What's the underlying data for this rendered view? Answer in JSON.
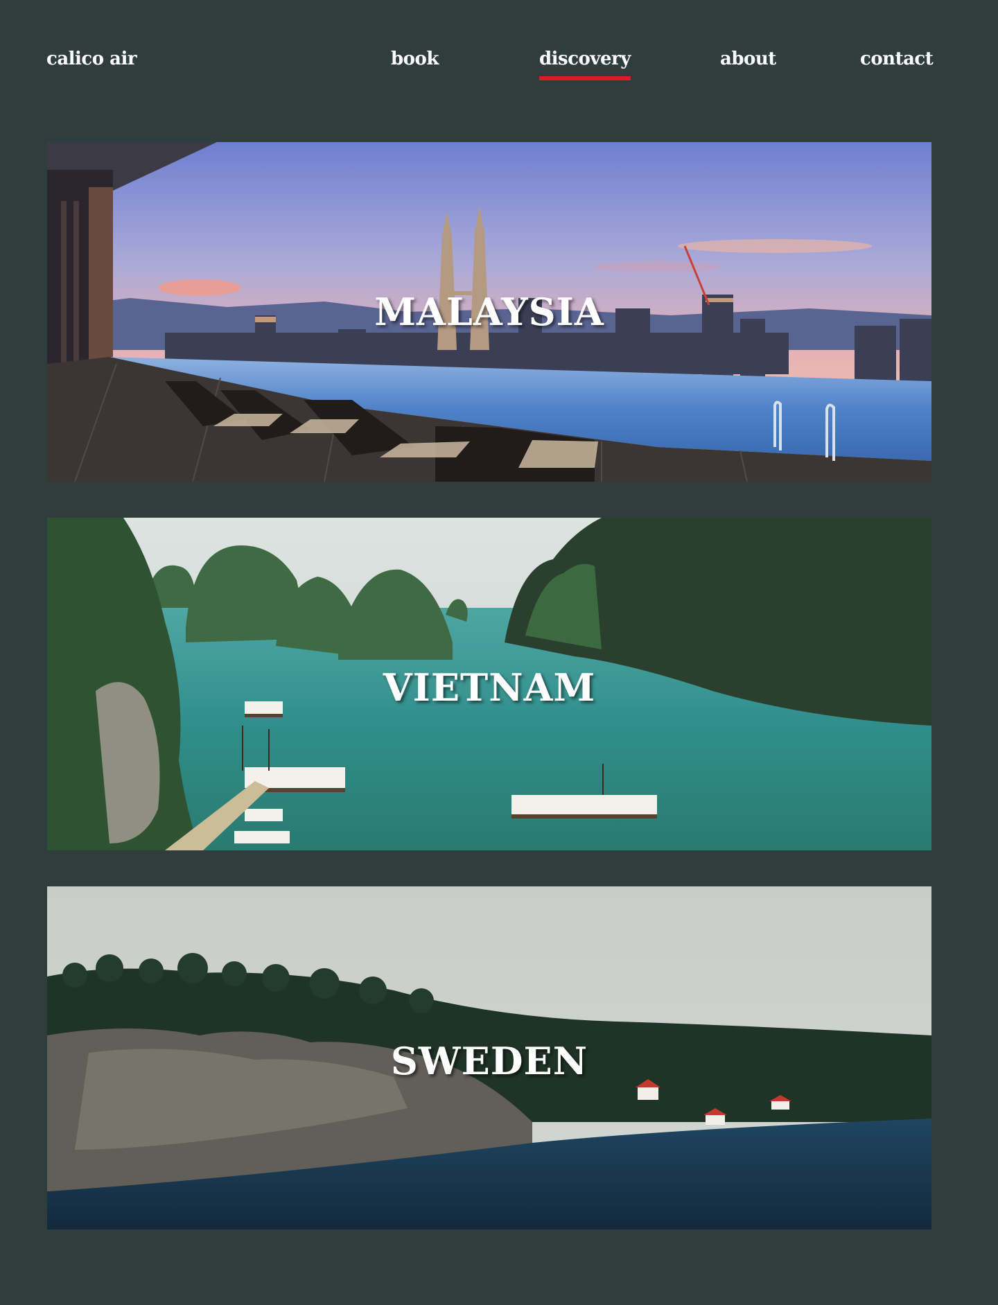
{
  "brand": "calico air",
  "nav": {
    "items": [
      {
        "label": "book",
        "active": false
      },
      {
        "label": "discovery",
        "active": true
      },
      {
        "label": "about",
        "active": false
      },
      {
        "label": "contact",
        "active": false
      }
    ]
  },
  "destinations": [
    {
      "name": "MALAYSIA"
    },
    {
      "name": "VIETNAM"
    },
    {
      "name": "SWEDEN"
    }
  ],
  "colors": {
    "background": "#2f3d3c",
    "accent": "#e01a22",
    "text": "#ffffff"
  }
}
